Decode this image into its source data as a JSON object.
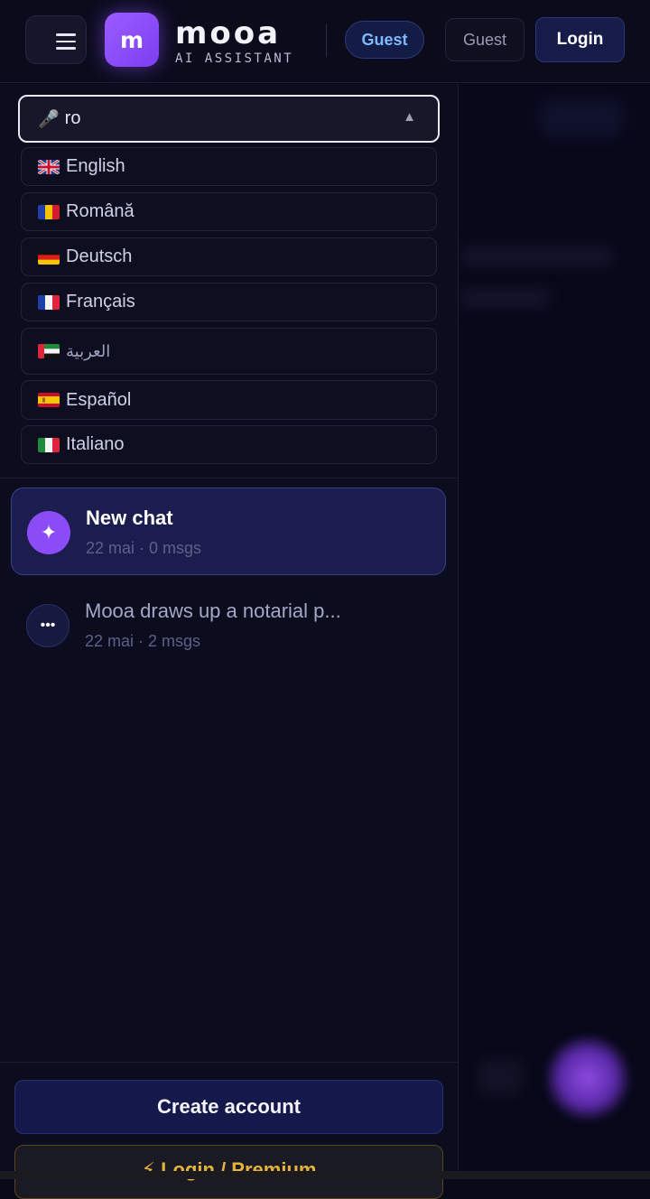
{
  "header": {
    "logo_letter": "m",
    "brand_name": "mooa",
    "brand_subtitle": "AI ASSISTANT",
    "guest_pill": "Guest",
    "guest_button": "Guest",
    "login_button": "Login"
  },
  "language_select": {
    "icon": "🎤",
    "value": "ro",
    "arrow": "▲",
    "options": [
      {
        "label": "English",
        "flag": "uk-flag"
      },
      {
        "label": "Română",
        "flag": "ro-flag"
      },
      {
        "label": "Deutsch",
        "flag": "de-flag"
      },
      {
        "label": "Français",
        "flag": "fr-flag"
      },
      {
        "label": "العربية",
        "flag": "ae-flag"
      },
      {
        "label": "Español",
        "flag": "es-flag"
      },
      {
        "label": "Italiano",
        "flag": "it-flag"
      }
    ]
  },
  "chats": [
    {
      "title": "New chat",
      "meta": "22 mai · 0 msgs",
      "icon": "sparkle-icon",
      "icon_glyph": "✦"
    },
    {
      "title": "Mooa draws up a notarial p...",
      "meta": "22 mai · 2 msgs",
      "icon": "chat-bubble-icon",
      "icon_glyph": "•••"
    }
  ],
  "footer": {
    "create_account": "Create account",
    "premium": "⚡ Login / Premium"
  },
  "colors": {
    "background": "#090919",
    "accent_purple": "#8b4cf7",
    "accent_blue": "#7fb8ff",
    "premium_gold": "#e5b23a"
  }
}
